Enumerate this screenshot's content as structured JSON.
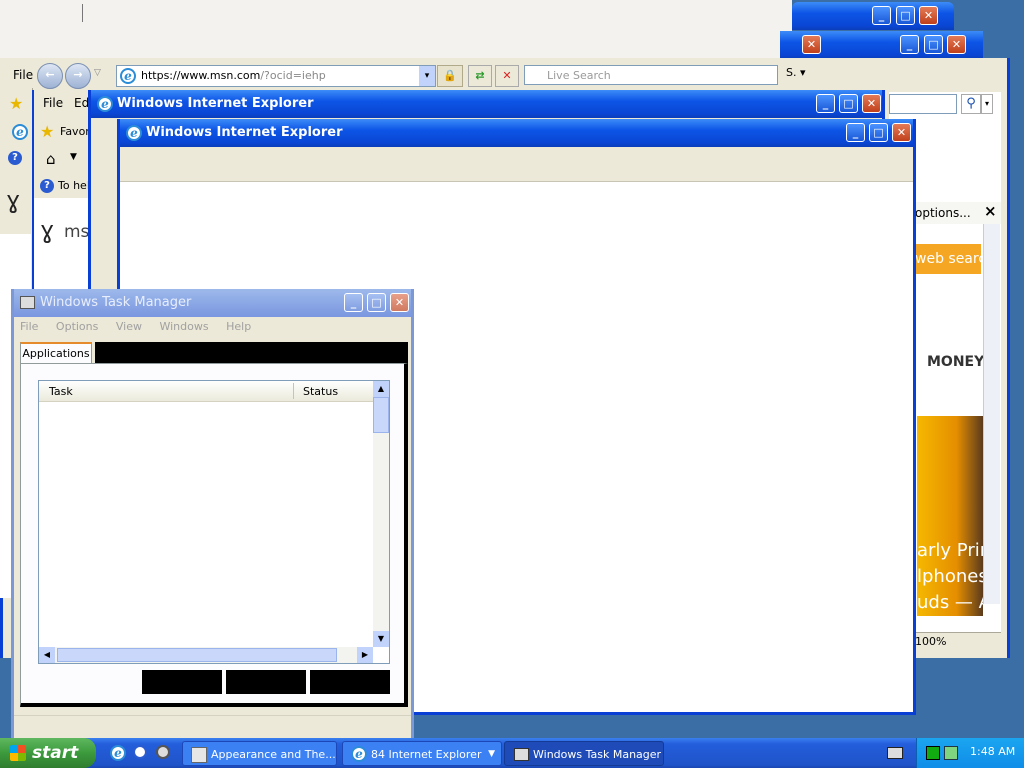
{
  "ie_back_window": {
    "menu": [
      "File",
      "Edit"
    ],
    "address_url_base": "https://www.msn.com",
    "address_url_query": "/?ocid=iehp",
    "search_placeholder": "Live Search",
    "favorites_label": "Favor",
    "help_text": "To help",
    "msn_logo_text": "ms",
    "page_options": "options...",
    "web_search": "web search",
    "money_label": "MONEY",
    "headline_lines": [
      "arly Prim",
      "lphones",
      "uds — A"
    ],
    "zoom": "100%",
    "close_glyph": "×"
  },
  "ie_windows": [
    {
      "title": "Windows Internet Explorer"
    },
    {
      "title": "Windows Internet Explorer"
    }
  ],
  "task_manager": {
    "title": "Windows Task Manager",
    "menu": [
      "File",
      "Options",
      "View",
      "Windows",
      "Help"
    ],
    "tab_label": "Applications",
    "columns": {
      "task": "Task",
      "status": "Status"
    }
  },
  "taskbar": {
    "start_label": "start",
    "buttons": [
      {
        "label": "Appearance and The..."
      },
      {
        "label": "84 Internet Explorer"
      },
      {
        "label": "Windows Task Manager"
      }
    ],
    "clock": "1:48 AM"
  },
  "colors": {
    "titlebar": "#0a46d4",
    "taskbar": "#245edb",
    "start": "#3c9a3c",
    "tray": "#0f8de8"
  }
}
